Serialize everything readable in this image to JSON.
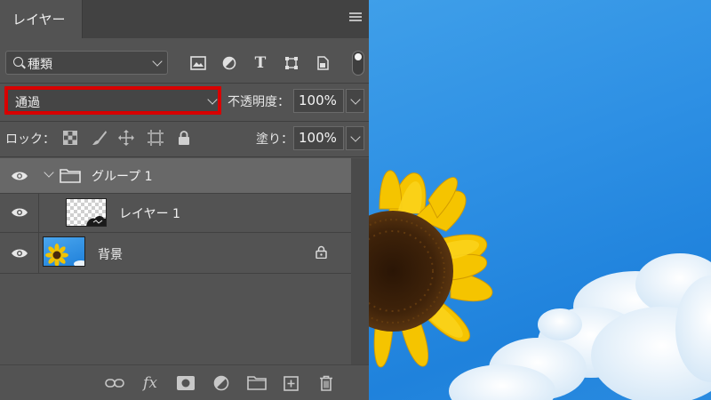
{
  "panel": {
    "tab_label": "レイヤー",
    "filter": {
      "label": "種類"
    },
    "blend_mode": "通過",
    "opacity": {
      "label": "不透明度：",
      "value": "100%"
    },
    "lock": {
      "label": "ロック："
    },
    "fill": {
      "label": "塗り：",
      "value": "100%"
    },
    "layers": [
      {
        "name": "グループ 1",
        "type": "group"
      },
      {
        "name": "レイヤー 1",
        "type": "layer"
      },
      {
        "name": "背景",
        "type": "background",
        "locked": true
      }
    ]
  },
  "colors": {
    "panel_bg": "#535353",
    "selected_row": "#686868",
    "highlight_border": "#d80000",
    "sky": "#2e90e4"
  },
  "icons": {
    "filter_icons": [
      "image-filter-icon",
      "adjustment-filter-icon",
      "type-filter-icon",
      "shape-filter-icon",
      "smart-object-filter-icon"
    ],
    "lock_icons": [
      "lock-transparent-pixels-icon",
      "lock-image-pixels-icon",
      "lock-position-icon",
      "lock-artboard-icon",
      "lock-all-icon"
    ],
    "bottom_icons": [
      "link-layers-icon",
      "fx-icon",
      "add-mask-icon",
      "new-adjustment-layer-icon",
      "new-group-icon",
      "new-layer-icon",
      "delete-layer-icon"
    ]
  }
}
